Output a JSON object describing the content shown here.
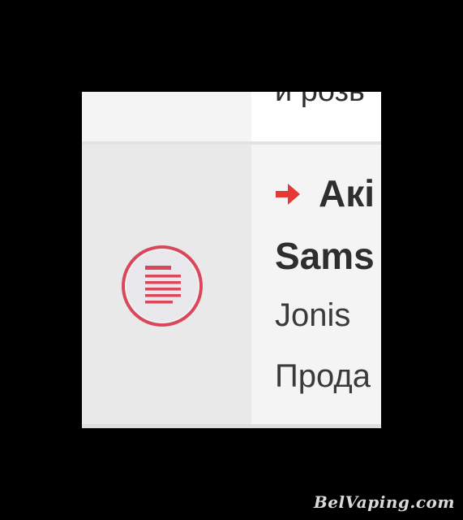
{
  "previous_row": {
    "snippet": "и розь"
  },
  "thread": {
    "title_line1": "Акі",
    "title_line2": "Sams",
    "author": "Jonis",
    "forum": "Прода"
  },
  "watermark": "BelVaping.com",
  "colors": {
    "accent": "#d9485a",
    "icon_bg": "#eeeeee"
  }
}
